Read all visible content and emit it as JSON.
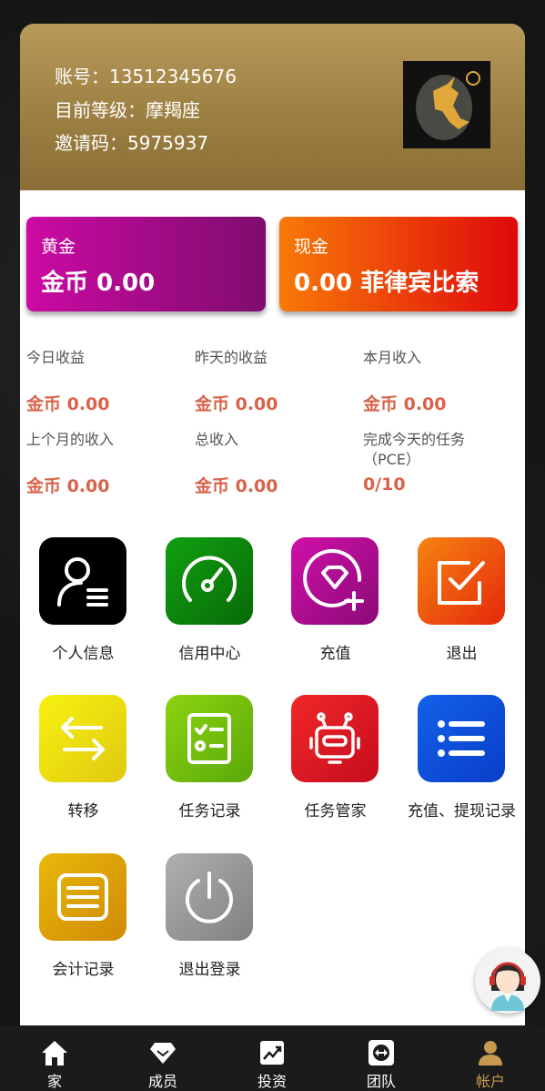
{
  "header": {
    "account_label": "账号：",
    "account": "13512345676",
    "level_label": "目前等级：",
    "level": "摩羯座",
    "invite_label": "邀请码：",
    "invite": "5975937"
  },
  "wallets": [
    {
      "label": "黄金",
      "amount": "金币 0.00"
    },
    {
      "label": "现金",
      "amount": "0.00 菲律宾比索"
    }
  ],
  "stats": [
    {
      "label": "今日收益",
      "value": "金币 0.00"
    },
    {
      "label": "昨天的收益",
      "value": "金币 0.00"
    },
    {
      "label": "本月收入",
      "value": "金币 0.00"
    },
    {
      "label": "上个月的收入",
      "value": "金币 0.00"
    },
    {
      "label": "总收入",
      "value": "金币 0.00"
    },
    {
      "label": "完成今天的任务（PCE）",
      "value": "0/10"
    }
  ],
  "menu": [
    {
      "label": "个人信息",
      "icon": "person-icon"
    },
    {
      "label": "信用中心",
      "icon": "gauge-icon"
    },
    {
      "label": "充值",
      "icon": "diamond-plus-icon"
    },
    {
      "label": "退出",
      "icon": "checkbox-icon"
    },
    {
      "label": "转移",
      "icon": "transfer-arrows-icon"
    },
    {
      "label": "任务记录",
      "icon": "task-list-icon"
    },
    {
      "label": "任务管家",
      "icon": "robot-icon"
    },
    {
      "label": "充值、提现记录",
      "icon": "list-icon"
    },
    {
      "label": "会计记录",
      "icon": "ledger-icon"
    },
    {
      "label": "退出登录",
      "icon": "power-icon"
    }
  ],
  "nav": [
    {
      "label": "家",
      "icon": "home-icon"
    },
    {
      "label": "成员",
      "icon": "diamond-icon"
    },
    {
      "label": "投资",
      "icon": "chart-icon"
    },
    {
      "label": "团队",
      "icon": "team-icon"
    },
    {
      "label": "帐户",
      "icon": "account-icon"
    }
  ],
  "colors": {
    "header_gold": "#a88a4a",
    "gold_card": "#b7088f",
    "cash_card": "#f25a08",
    "accent_value": "#d9634a",
    "nav_active": "#c69a4f"
  }
}
